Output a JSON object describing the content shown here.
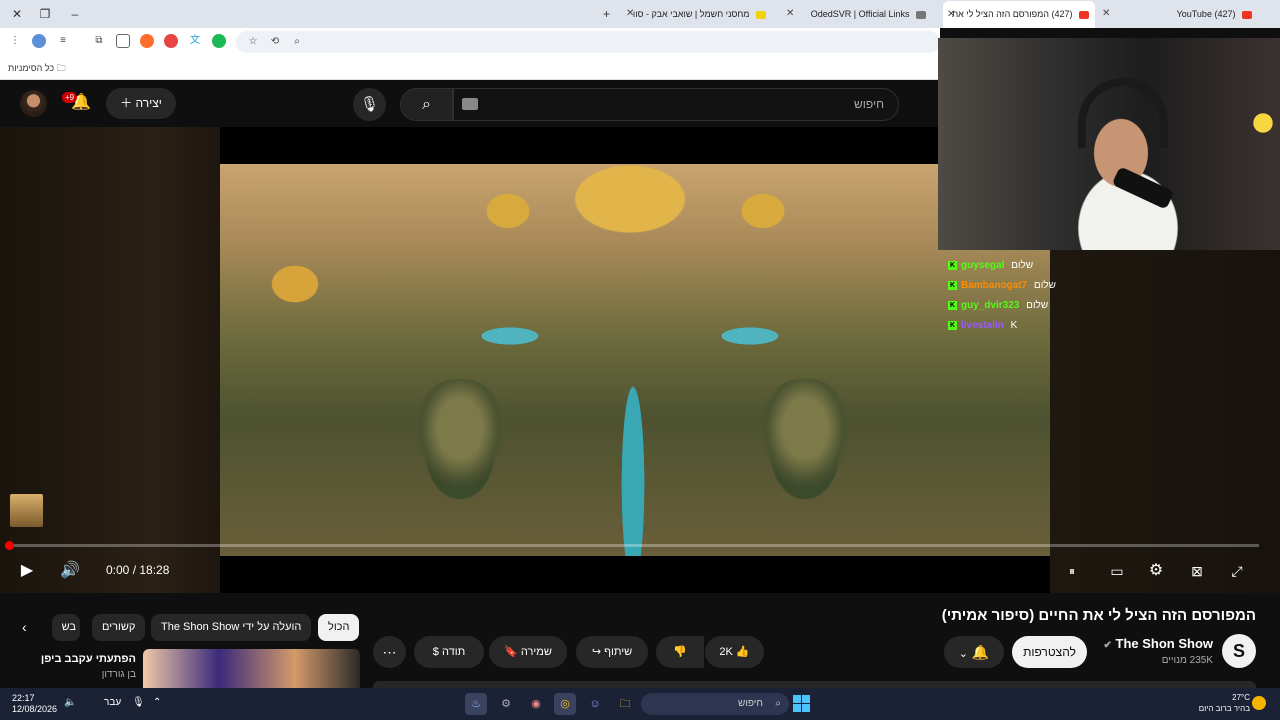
{
  "browser": {
    "tabs": [
      {
        "title": "(427) YouTube",
        "active": false
      },
      {
        "title": "(427) המפורסם הזה הציל לי את",
        "active": true
      },
      {
        "title": "OdedSVR | Official Links",
        "active": false
      },
      {
        "title": "מחסני חשמל | שואבי אבק - סוו",
        "active": false
      }
    ],
    "bookmarks_label": "כל הסימניות"
  },
  "youtube": {
    "notification_count": "+9",
    "create_label": "יצירה",
    "search_placeholder": "חיפוש"
  },
  "player": {
    "time": "0:00 / 18:28",
    "progress": 0.0
  },
  "chat": [
    {
      "user": "guysegal",
      "message": "שלום",
      "color": "#53fc18"
    },
    {
      "user": "Bambanogat7",
      "message": "שלום",
      "color": "#ff8c00"
    },
    {
      "user": "guy_dvir323",
      "message": "שלום",
      "color": "#53fc18"
    },
    {
      "user": "livestalin",
      "message": "K",
      "color": "#9b59ff"
    }
  ],
  "video": {
    "title": "המפורסם הזה הציל לי את החיים (סיפור אמיתי)",
    "channel": "The Shon Show",
    "subscribers": "235K מנויים",
    "join_label": "להצטרפות",
    "likes": "2K",
    "share_label": "שיתוף",
    "save_label": "שמירה",
    "thanks_label": "תודה"
  },
  "filter_chips": {
    "all": "הכול",
    "uploaded_by": "הועלה על ידי The Shon Show",
    "related": "קשורים",
    "partial": "בש"
  },
  "recommendation": {
    "title": "הפתעתי עקבב ביפן",
    "channel": "בן גורדון"
  },
  "taskbar": {
    "time": "22:17",
    "date": "12/08/2026",
    "lang": "עבר",
    "search_label": "חיפוש",
    "weather_temp": "27°C",
    "weather_desc": "בהיר ברוב היום"
  },
  "colors": {
    "accent": "#ff0000",
    "kick_green": "#53fc18"
  }
}
